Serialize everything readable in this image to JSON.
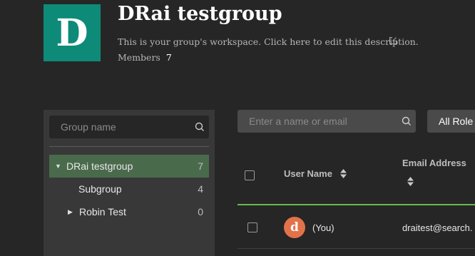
{
  "group": {
    "logo_letter": "D",
    "name": "DRai testgroup",
    "description": "This is your group's workspace. Click here to edit this description.",
    "members_label": "Members",
    "members_count": "7"
  },
  "sidebar": {
    "search_placeholder": "Group name",
    "items": [
      {
        "label": "DRai testgroup",
        "count": "7",
        "expanded": true,
        "selected": true
      },
      {
        "label": "Subgroup",
        "count": "4"
      },
      {
        "label": "Robin Test",
        "count": "0",
        "expanded": false
      }
    ]
  },
  "users": {
    "search_placeholder": "Enter a name or email",
    "role_filter": "All Role",
    "columns": {
      "user_name": "User Name",
      "email": "Email Address"
    },
    "rows": [
      {
        "avatar_letter": "d",
        "name": "(You)",
        "email": "draitest@search."
      }
    ]
  },
  "colors": {
    "logo_bg": "#0d8b78",
    "selected_bg": "#4a6a4c",
    "accent_line": "#66bb4c",
    "avatar_bg": "#e2724a"
  },
  "icons": [
    "edit-icon",
    "search-icon",
    "caret-down-icon",
    "caret-right-icon",
    "sort-icon"
  ]
}
